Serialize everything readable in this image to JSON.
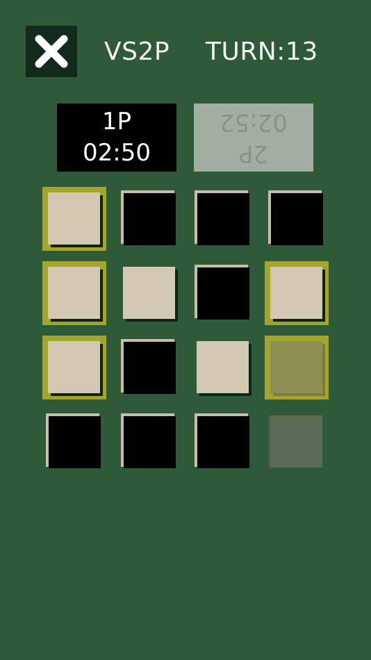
{
  "header": {
    "close_icon": "close-x-icon",
    "mode_label": "VS2P",
    "turn_label": "TURN:13"
  },
  "players": {
    "p1": {
      "name": "1P",
      "time": "02:50",
      "active": true
    },
    "p2": {
      "name": "2P",
      "time": "02:52",
      "active": false
    }
  },
  "colors": {
    "background": "#2e5a3a",
    "light_tile": "#d2c8b3",
    "dark_tile": "#000000",
    "highlight": "#a3a42c",
    "p1_panel": "#000000",
    "p2_panel": "#a2aea2"
  },
  "board": {
    "rows": 4,
    "cols": 4,
    "tiles": [
      [
        "light",
        "dark",
        "dark",
        "dark"
      ],
      [
        "light",
        "light",
        "dark",
        "light"
      ],
      [
        "light",
        "dark",
        "light",
        "ghost-highlight"
      ],
      [
        "dark",
        "dark",
        "dark",
        "ghost"
      ]
    ],
    "highlighted": [
      [
        0,
        0
      ],
      [
        1,
        0
      ],
      [
        1,
        3
      ],
      [
        2,
        0
      ],
      [
        2,
        3
      ]
    ]
  }
}
